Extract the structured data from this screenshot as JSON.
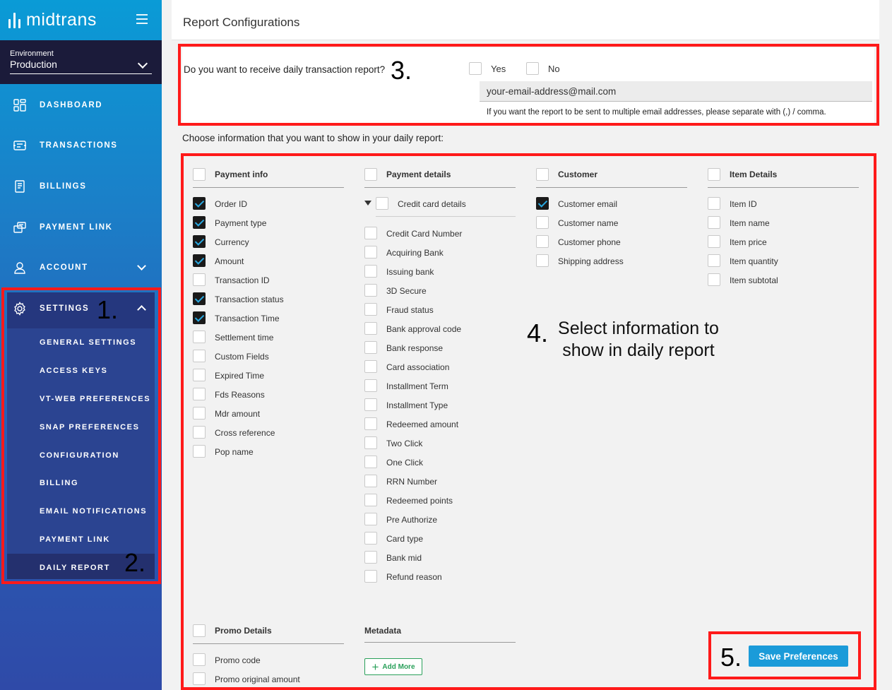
{
  "brand": {
    "name": "midtrans"
  },
  "environment": {
    "label": "Environment",
    "value": "Production"
  },
  "nav": {
    "dashboard": "DASHBOARD",
    "transactions": "TRANSACTIONS",
    "billings": "BILLINGS",
    "payment_link": "PAYMENT LINK",
    "account": "ACCOUNT",
    "settings": "SETTINGS"
  },
  "settings_submenu": [
    "GENERAL SETTINGS",
    "ACCESS KEYS",
    "VT-WEB PREFERENCES",
    "SNAP PREFERENCES",
    "CONFIGURATION",
    "BILLING",
    "EMAIL NOTIFICATIONS",
    "PAYMENT LINK",
    "DAILY REPORT"
  ],
  "page": {
    "title": "Report Configurations"
  },
  "daily_report_question": {
    "text": "Do you want to receive daily transaction report?",
    "yes_label": "Yes",
    "no_label": "No",
    "email_value": "your-email-address@mail.com",
    "hint": "If you want the report to be sent to multiple email addresses, please separate with (,) / comma."
  },
  "choose_text": "Choose information that you want to show in your daily report:",
  "columns": {
    "payment_info": {
      "title": "Payment info",
      "items": [
        {
          "label": "Order ID",
          "checked": true
        },
        {
          "label": "Payment type",
          "checked": true
        },
        {
          "label": "Currency",
          "checked": true
        },
        {
          "label": "Amount",
          "checked": true
        },
        {
          "label": "Transaction ID",
          "checked": false
        },
        {
          "label": "Transaction status",
          "checked": true
        },
        {
          "label": "Transaction Time",
          "checked": true
        },
        {
          "label": "Settlement time",
          "checked": false
        },
        {
          "label": "Custom Fields",
          "checked": false
        },
        {
          "label": "Expired Time",
          "checked": false
        },
        {
          "label": "Fds Reasons",
          "checked": false
        },
        {
          "label": "Mdr amount",
          "checked": false
        },
        {
          "label": "Cross reference",
          "checked": false
        },
        {
          "label": "Pop name",
          "checked": false
        }
      ]
    },
    "payment_details": {
      "title": "Payment details",
      "group": "Credit card details",
      "items": [
        "Credit Card Number",
        "Acquiring Bank",
        "Issuing bank",
        "3D Secure",
        "Fraud status",
        "Bank approval code",
        "Bank response",
        "Card association",
        "Installment Term",
        "Installment Type",
        "Redeemed amount",
        "Two Click",
        "One Click",
        "RRN Number",
        "Redeemed points",
        "Pre Authorize",
        "Card type",
        "Bank mid",
        "Refund reason"
      ]
    },
    "customer": {
      "title": "Customer",
      "items": [
        {
          "label": "Customer email",
          "checked": true
        },
        {
          "label": "Customer name",
          "checked": false
        },
        {
          "label": "Customer phone",
          "checked": false
        },
        {
          "label": "Shipping address",
          "checked": false
        }
      ]
    },
    "item_details": {
      "title": "Item Details",
      "items": [
        "Item ID",
        "Item name",
        "Item price",
        "Item quantity",
        "Item subtotal"
      ]
    }
  },
  "promo": {
    "title": "Promo Details",
    "items": [
      "Promo code",
      "Promo original amount"
    ]
  },
  "metadata": {
    "title": "Metadata",
    "add_more": "Add More"
  },
  "save_button": "Save Preferences",
  "annotations": {
    "one": "1.",
    "two": "2.",
    "three": "3.",
    "four": "4.",
    "four_text_line1": "Select information to",
    "four_text_line2": "show in daily report",
    "five": "5."
  }
}
